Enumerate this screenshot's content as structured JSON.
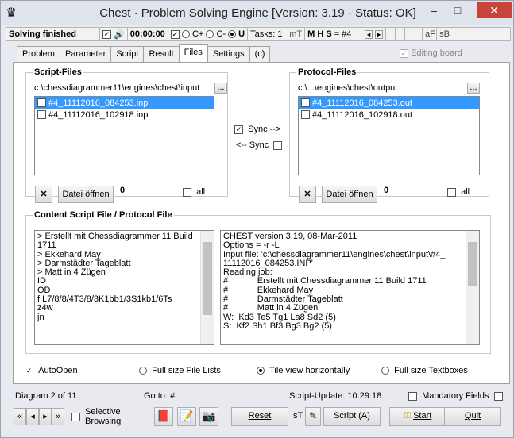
{
  "window": {
    "title": "Chest · Problem Solving Engine [Version: 3.19 · Status: OK]",
    "minimize": "–",
    "maximize": "□",
    "close": "✕"
  },
  "toolbar": {
    "status": "Solving finished",
    "speaker_icon": "🔊",
    "time": "00:00:00",
    "opt_c_plus": "C+",
    "opt_c_minus": "C-",
    "opt_u": "U",
    "tasks": "Tasks: 1",
    "mt": "mT",
    "mhs": "M H S",
    "equals": "=",
    "depth": "#4",
    "af": "aF",
    "sb": "sB"
  },
  "tabs": [
    "Problem",
    "Parameter",
    "Script",
    "Result",
    "Files",
    "Settings",
    "(c)"
  ],
  "editing_board": "Editing board",
  "script_files": {
    "title": "Script-Files",
    "path": "c:\\chessdiagrammer11\\engines\\chest\\input",
    "browse": "...",
    "items": [
      "#4_11112016_084253.inp",
      "#4_11112016_102918.inp"
    ],
    "count": "0",
    "open": "Datei öffnen",
    "all": "all",
    "delete": "✕"
  },
  "protocol_files": {
    "title": "Protocol-Files",
    "path": "c:\\...\\engines\\chest\\output",
    "browse": "...",
    "items": [
      "#4_11112016_084253.out",
      "#4_11112016_102918.out"
    ],
    "count": "0",
    "open": "Datei öffnen",
    "all": "all",
    "delete": "✕"
  },
  "sync": {
    "forward": "Sync -->",
    "back": "<-- Sync"
  },
  "content": {
    "title": "Content Script File / Protocol File",
    "script_lines": [
      "> Erstellt mit Chessdiagrammer 11 Build",
      "1711",
      "> Ekkehard May",
      "> Darmstädter Tageblatt",
      "> Matt in 4 Zügen",
      "ID",
      "OD",
      "f L7/8/8/4T3/8/3K1bb1/3S1kb1/6Ts",
      "z4w",
      "jn"
    ],
    "protocol_lines": [
      "CHEST version 3.19, 08-Mar-2011",
      "Options = -r -L",
      "Input file: 'c:\\chessdiagrammer11\\engines\\chest\\input\\#4_",
      "11112016_084253.INP'",
      "Reading job:",
      "#            Erstellt mit Chessdiagrammer 11 Build 1711",
      "#            Ekkehard May",
      "#            Darmstädter Tageblatt",
      "#            Matt in 4 Zügen",
      "W:  Kd3 Te5 Tg1 La8 Sd2 (5)",
      "S:  Kf2 Sh1 Bf3 Bg3 Bg2 (5)"
    ]
  },
  "options": {
    "autoopen": "AutoOpen",
    "full_file_lists": "Full size File Lists",
    "tile_horizontal": "Tile view horizontally",
    "full_textboxes": "Full size Textboxes"
  },
  "status": {
    "diagram": "Diagram 2 of 11",
    "goto": "Go to: #",
    "script_update": "Script-Update: 10:29:18",
    "mandatory": "Mandatory Fields"
  },
  "bottom": {
    "selective": "Selective",
    "browsing": "Browsing",
    "reset": "Reset",
    "st": "sT",
    "script_a": "Script (A)",
    "start": "Start",
    "quit": "Quit"
  }
}
